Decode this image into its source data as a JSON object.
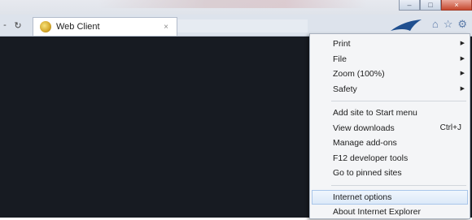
{
  "window": {
    "controls": [
      "–",
      "□",
      "×"
    ]
  },
  "tab": {
    "title": "Web Client",
    "close": "×"
  },
  "nav": {
    "back": "-",
    "refresh": "↻"
  },
  "toolbar": {
    "home": "⌂",
    "favorites": "☆",
    "tools": "⚙"
  },
  "menu": {
    "items": [
      {
        "label": "Print",
        "submenu": true
      },
      {
        "label": "File",
        "submenu": true
      },
      {
        "label": "Zoom (100%)",
        "submenu": true
      },
      {
        "label": "Safety",
        "submenu": true
      },
      {
        "label": "Add site to Start menu"
      },
      {
        "label": "View downloads",
        "shortcut": "Ctrl+J"
      },
      {
        "label": "Manage add-ons"
      },
      {
        "label": "F12 developer tools"
      },
      {
        "label": "Go to pinned sites"
      },
      {
        "label": "Internet options",
        "highlighted": true
      },
      {
        "label": "About Internet Explorer"
      }
    ]
  },
  "colors": {
    "page_background": "#171b22",
    "menu_background": "#f4f5f7",
    "highlight": "#dce9f8"
  }
}
